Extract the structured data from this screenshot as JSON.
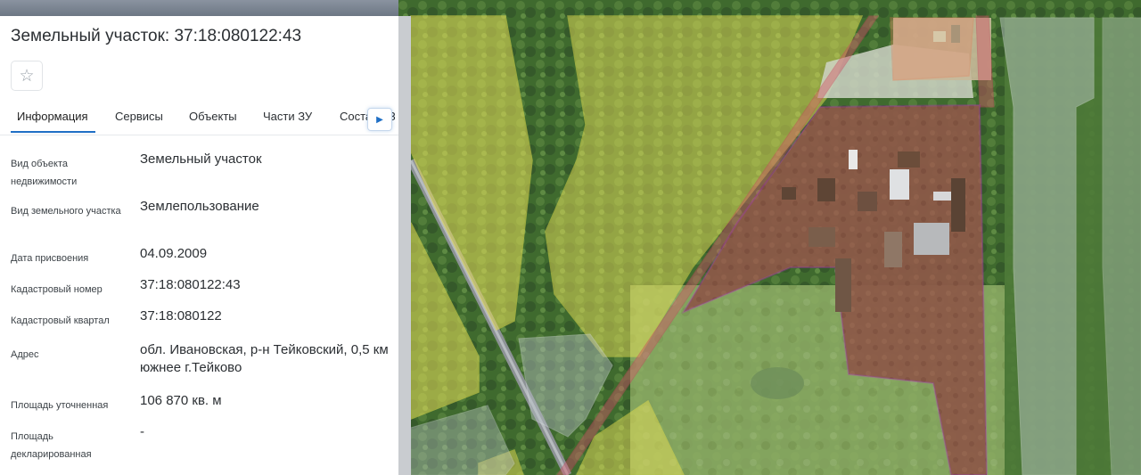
{
  "panel": {
    "title": "Земельный участок: 37:18:080122:43",
    "favorite_icon": "star-icon",
    "tabs": [
      {
        "label": "Информация",
        "active": true
      },
      {
        "label": "Сервисы",
        "active": false
      },
      {
        "label": "Объекты",
        "active": false
      },
      {
        "label": "Части ЗУ",
        "active": false
      },
      {
        "label": "Состав ЕЗП",
        "active": false
      }
    ],
    "tab_scroll_icon": "chevron-right-icon",
    "fields": [
      {
        "label": "Вид объекта недвижимости",
        "value": "Земельный участок"
      },
      {
        "label": "Вид земельного участка",
        "value": "Землепользование"
      },
      {
        "label": "Дата присвоения",
        "value": "04.09.2009"
      },
      {
        "label": "Кадастровый номер",
        "value": "37:18:080122:43"
      },
      {
        "label": "Кадастровый квартал",
        "value": "37:18:080122"
      },
      {
        "label": "Адрес",
        "value": "обл. Ивановская, р-н Тейковский, 0,5 км южнее г.Тейково"
      },
      {
        "label": "Площадь уточненная",
        "value": "106 870 кв. м"
      },
      {
        "label": "Площадь декларированная",
        "value": "-"
      }
    ]
  },
  "map": {
    "colors": {
      "parcel_outline": "#c026d3",
      "neighbor_fill": "#e8e15a",
      "selected_fill": "#b04a4a",
      "accent": "#1f6fc5"
    }
  }
}
